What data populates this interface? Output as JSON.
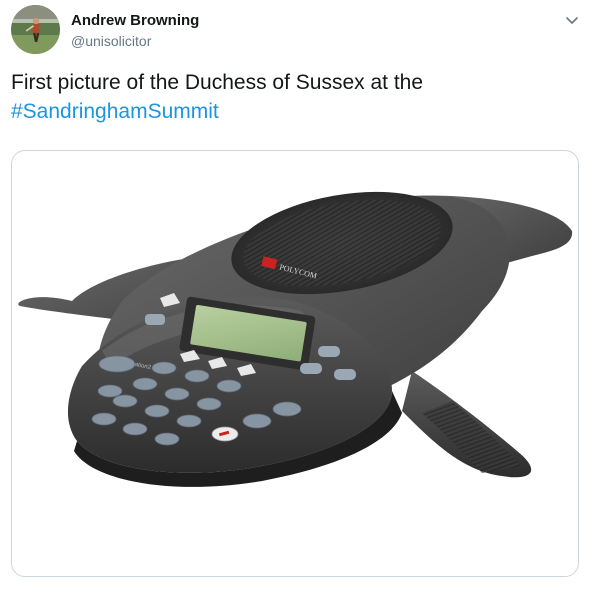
{
  "author": {
    "display_name": "Andrew Browning",
    "handle": "@unisolicitor",
    "avatar_icon": "profile-avatar"
  },
  "tweet": {
    "text_prefix": "First picture of the Duchess of Sussex at the ",
    "hashtag": "#SandringhamSummit"
  },
  "media": {
    "subject": "conference-speakerphone",
    "brand_text": "POLYCOM",
    "model_text": "SoundStation2"
  },
  "colors": {
    "text": "#14171a",
    "secondary": "#657786",
    "link": "#1b95e0",
    "border": "#ccd6dd"
  },
  "menu": {
    "icon": "chevron-down-icon"
  }
}
